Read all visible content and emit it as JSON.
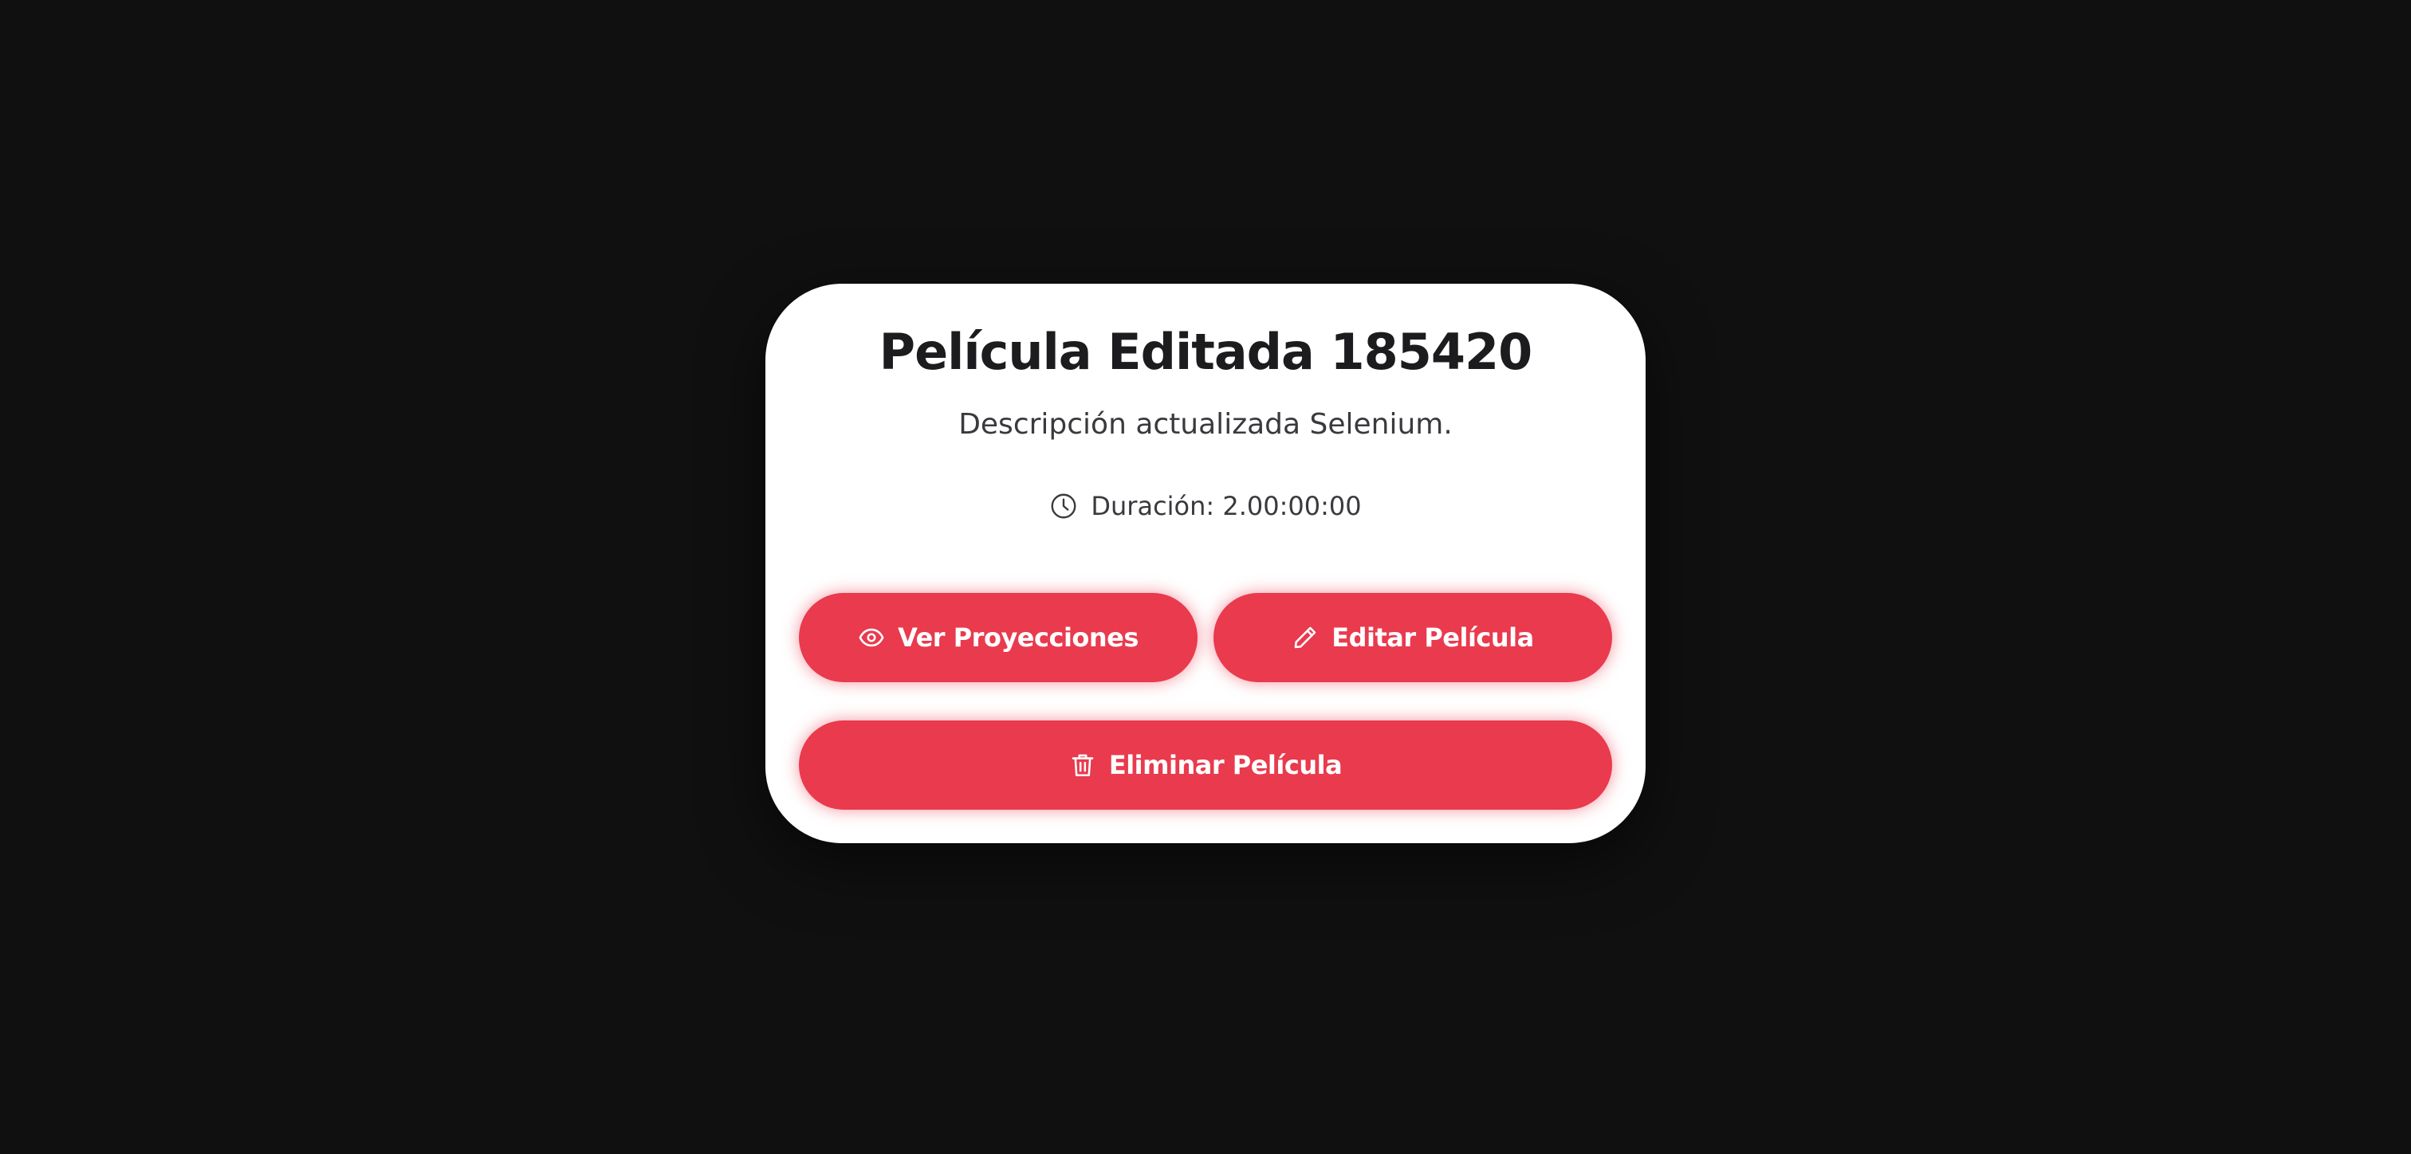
{
  "colors": {
    "background": "#101010",
    "card": "#ffffff",
    "accent": "#e93a4e",
    "title_text": "#1c1c1e",
    "body_text": "#3a3a3e"
  },
  "movie": {
    "title": "Película Editada 185420",
    "description": "Descripción actualizada Selenium.",
    "duration_icon": "clock-icon",
    "duration": "Duración: 2.00:00:00"
  },
  "actions": {
    "view": {
      "label": "Ver Proyecciones",
      "icon": "eye-icon"
    },
    "edit": {
      "label": "Editar Película",
      "icon": "pencil-icon"
    },
    "delete": {
      "label": "Eliminar Película",
      "icon": "trash-icon"
    }
  }
}
